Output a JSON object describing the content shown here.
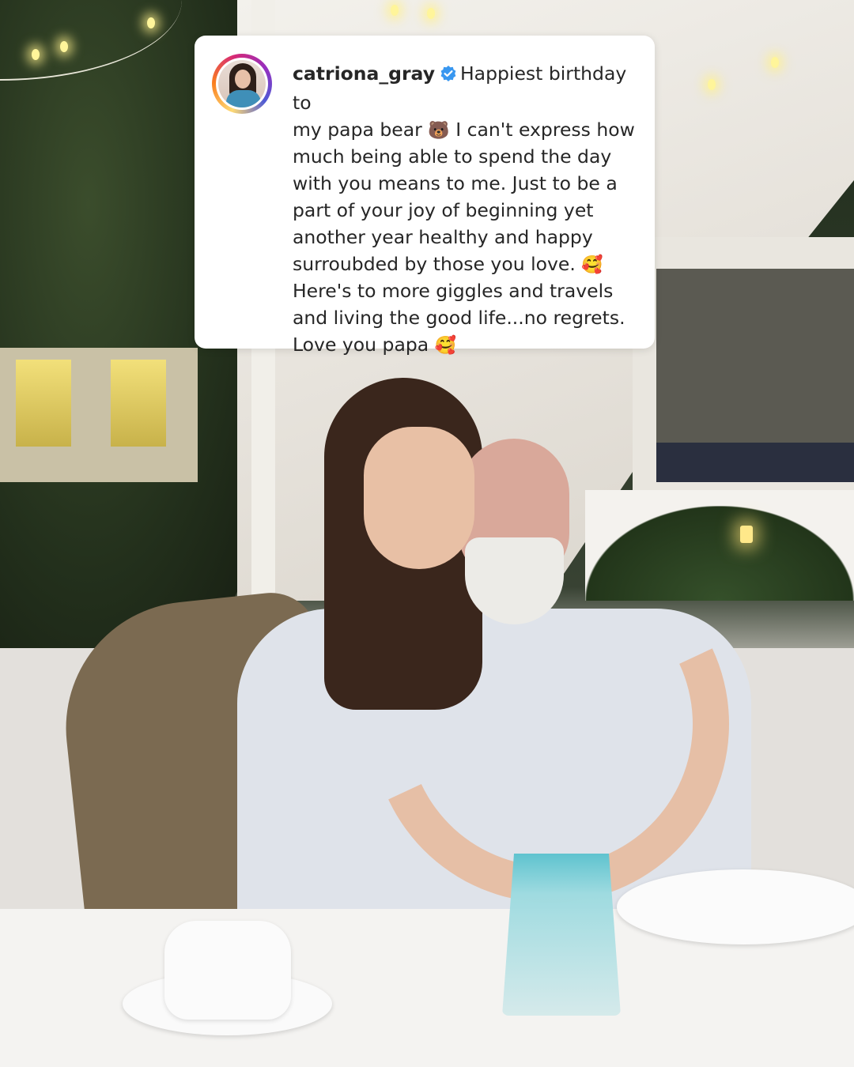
{
  "post": {
    "username": "catriona_gray",
    "verified": true,
    "caption_lines": [
      "Happiest birthday to",
      "my papa bear",
      "I can't express how",
      "much being able to spend the day",
      "with you means to me. Just to be a",
      "part of your joy of beginning yet",
      "another year healthy and happy",
      "surroubded by those you love.",
      "Here's to more giggles and travels",
      "and living the good life...no regrets.",
      "Love you papa"
    ],
    "emojis": {
      "bear": "🐻",
      "smile_hearts_1": "🥰",
      "smile_hearts_2": "🥰"
    }
  },
  "colors": {
    "card_bg": "#ffffff",
    "text": "#262626",
    "verified_badge": "#3897f0"
  },
  "icons": {
    "avatar": "profile-photo",
    "verified": "verified-badge-icon"
  }
}
